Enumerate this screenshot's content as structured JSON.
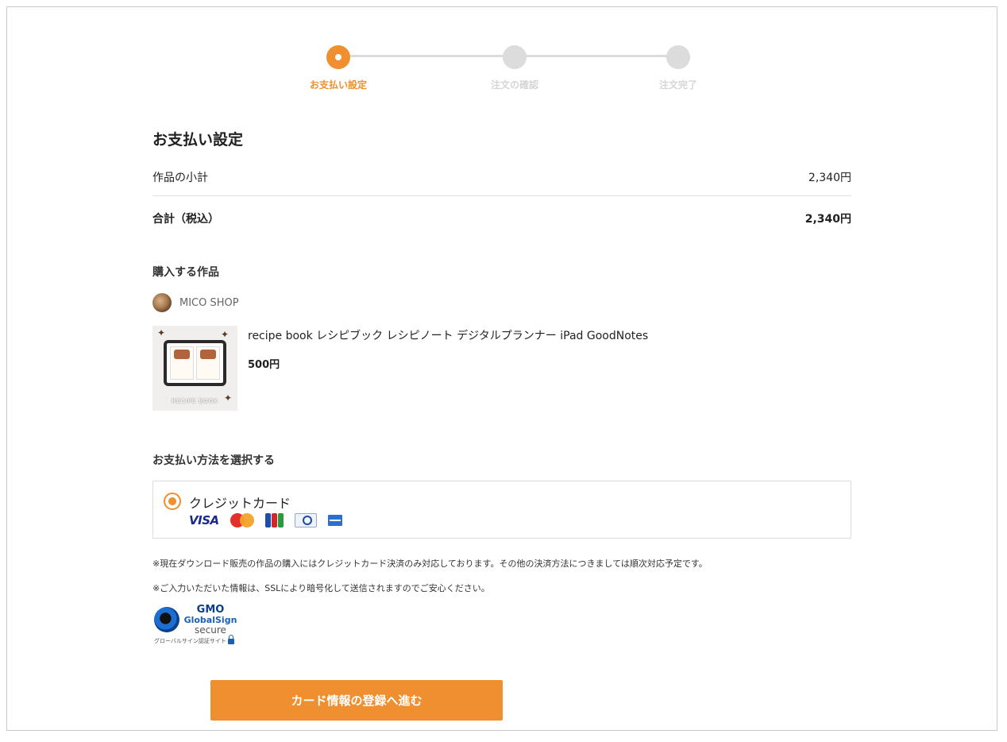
{
  "stepper": {
    "steps": [
      {
        "label": "お支払い設定",
        "state": "active"
      },
      {
        "label": "注文の確認",
        "state": "inactive"
      },
      {
        "label": "注文完了",
        "state": "inactive"
      }
    ]
  },
  "page": {
    "title": "お支払い設定"
  },
  "summary": {
    "subtotal_label": "作品の小計",
    "subtotal_value": "2,340円",
    "total_label": "合計（税込）",
    "total_value": "2,340円"
  },
  "items": {
    "heading": "購入する作品",
    "shop_name": "MICO SHOP",
    "product": {
      "name": "recipe book レシピブック レシピノート デジタルプランナー iPad GoodNotes",
      "price": "500円",
      "thumb_caption": "RECIPE BOOK"
    }
  },
  "payment": {
    "heading": "お支払い方法を選択する",
    "method_label": "クレジットカード",
    "selected": true,
    "cards": [
      "VISA",
      "MasterCard",
      "JCB",
      "Diners Club",
      "American Express"
    ],
    "visa_text": "VISA"
  },
  "notes": {
    "n1": "※現在ダウンロード販売の作品の購入にはクレジットカード決済のみ対応しております。その他の決済方法につきましては順次対応予定です。",
    "n2": "※ご入力いただいた情報は、SSLにより暗号化して送信されますのでご安心ください。"
  },
  "seal": {
    "brand": "GMO",
    "name": "GlobalSign",
    "secure": "secure",
    "caption": "グローバルサイン認証サイト"
  },
  "actions": {
    "submit_label": "カード情報の登録へ進む"
  },
  "colors": {
    "accent": "#ef8f2f",
    "inactive_step": "#dcdcdc"
  }
}
